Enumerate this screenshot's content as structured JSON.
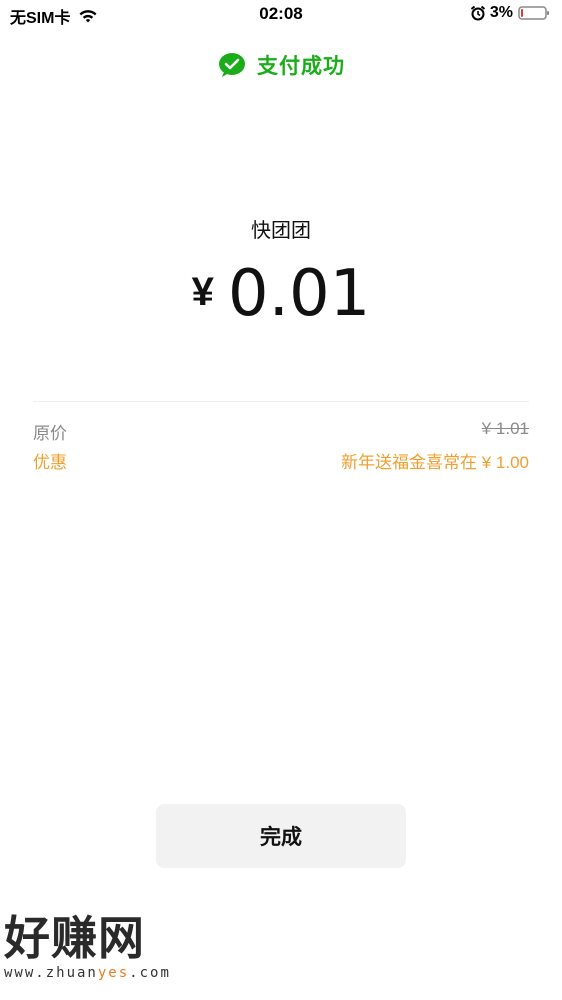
{
  "status_bar": {
    "carrier": "无SIM卡",
    "time": "02:08",
    "battery": "3%"
  },
  "header": {
    "status": "支付成功"
  },
  "payment": {
    "merchant": "快团团",
    "currency": "¥",
    "amount": "0.01"
  },
  "details": {
    "original_label": "原价",
    "original_value": "¥ 1.01",
    "discount_label": "优惠",
    "discount_value": "新年送福金喜常在 ¥ 1.00"
  },
  "actions": {
    "done_label": "完成"
  },
  "watermark": {
    "title": "好赚网",
    "url_prefix": "www.zhuan",
    "url_highlight": "yes",
    "url_suffix": ".com"
  },
  "colors": {
    "success_green": "#1aad19",
    "discount_orange": "#f0a030",
    "battery_low_red": "#e53935"
  }
}
